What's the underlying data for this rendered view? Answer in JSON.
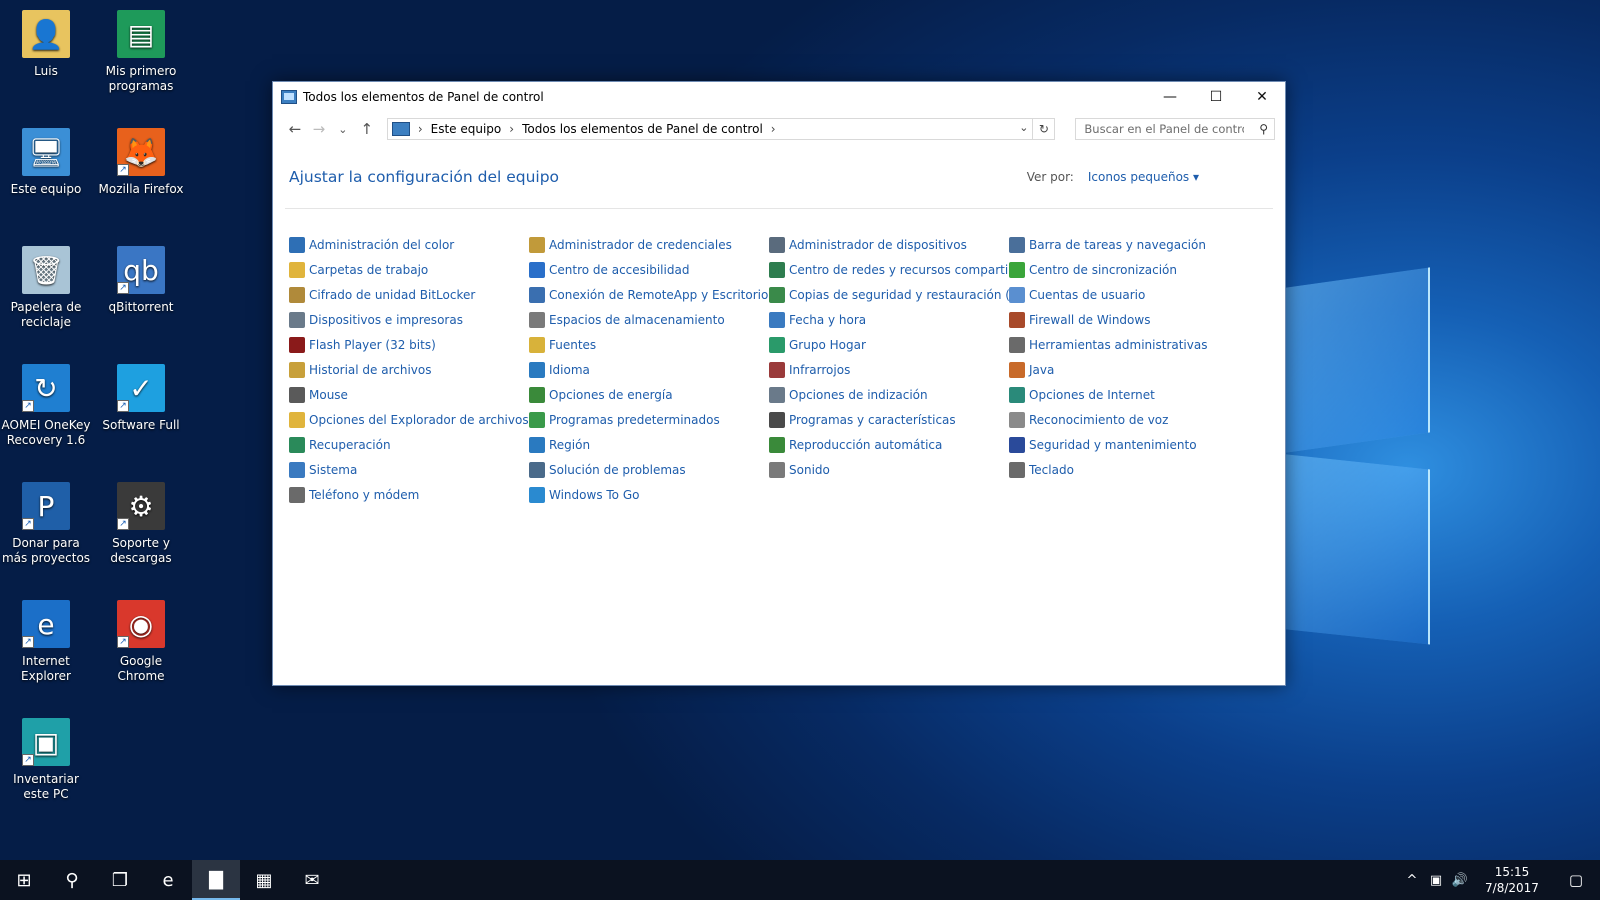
{
  "desktop": {
    "icons": [
      {
        "label": "Luis",
        "icon": "user-folder-icon",
        "bg": "#e8c45f",
        "glyph": "👤"
      },
      {
        "label": "Mis primero programas",
        "icon": "programs-shortcut-icon",
        "bg": "#1e9a5a",
        "glyph": "▤"
      },
      {
        "label": "Este equipo",
        "icon": "computer-icon",
        "bg": "#3b8fd6",
        "glyph": "🖥"
      },
      {
        "label": "Mozilla Firefox",
        "icon": "firefox-icon",
        "bg": "#e8611c",
        "glyph": "🦊"
      },
      {
        "label": "Papelera de reciclaje",
        "icon": "recycle-bin-icon",
        "bg": "#a9c4d6",
        "glyph": "🗑"
      },
      {
        "label": "qBittorrent",
        "icon": "qbittorrent-icon",
        "bg": "#3a76c4",
        "glyph": "qb"
      },
      {
        "label": "AOMEI OneKey Recovery 1.6",
        "icon": "aomei-recovery-icon",
        "bg": "#1f7fd1",
        "glyph": "↻"
      },
      {
        "label": "Software Full",
        "icon": "software-full-icon",
        "bg": "#1ea0e0",
        "glyph": "✓"
      },
      {
        "label": "Donar para más proyectos",
        "icon": "paypal-icon",
        "bg": "#1f5fa8",
        "glyph": "P"
      },
      {
        "label": "Soporte y descargas",
        "icon": "support-gear-icon",
        "bg": "#3a3a3a",
        "glyph": "⚙"
      },
      {
        "label": "Internet Explorer",
        "icon": "internet-explorer-icon",
        "bg": "#1b6fc8",
        "glyph": "e"
      },
      {
        "label": "Google Chrome",
        "icon": "chrome-icon",
        "bg": "#d9382c",
        "glyph": "◉"
      },
      {
        "label": "Inventariar este PC",
        "icon": "inventory-icon",
        "bg": "#1fa0a8",
        "glyph": "▣"
      }
    ]
  },
  "window": {
    "title": "Todos los elementos de Panel de control",
    "minimize_label": "—",
    "maximize_label": "☐",
    "close_label": "✕",
    "nav": {
      "back": "←",
      "forward": "→",
      "recent": "⌄",
      "up": "↑"
    },
    "breadcrumb": [
      "Este equipo",
      "Todos los elementos de Panel de control"
    ],
    "breadcrumb_sep": "›",
    "search_placeholder": "Buscar en el Panel de control",
    "heading": "Ajustar la configuración del equipo",
    "view_by_label": "Ver por:",
    "view_by_value": "Iconos pequeños ▾"
  },
  "control_panel_items": [
    {
      "label": "Administración del color",
      "icon": "color-management-icon",
      "color": "#2e6fb5"
    },
    {
      "label": "Administrador de credenciales",
      "icon": "credential-manager-icon",
      "color": "#c19a3a"
    },
    {
      "label": "Administrador de dispositivos",
      "icon": "device-manager-icon",
      "color": "#5a6b7d"
    },
    {
      "label": "Barra de tareas y navegación",
      "icon": "taskbar-icon",
      "color": "#4a6f9a"
    },
    {
      "label": "Carpetas de trabajo",
      "icon": "work-folders-icon",
      "color": "#e0b43c"
    },
    {
      "label": "Centro de accesibilidad",
      "icon": "accessibility-icon",
      "color": "#2a6fc9"
    },
    {
      "label": "Centro de redes y recursos comparti...",
      "icon": "network-center-icon",
      "color": "#2e7d4f"
    },
    {
      "label": "Centro de sincronización",
      "icon": "sync-center-icon",
      "color": "#3aa53a"
    },
    {
      "label": "Cifrado de unidad BitLocker",
      "icon": "bitlocker-icon",
      "color": "#b08a3a"
    },
    {
      "label": "Conexión de RemoteApp y Escritorio",
      "icon": "remoteapp-icon",
      "color": "#3a6fb0"
    },
    {
      "label": "Copias de seguridad y restauración (...",
      "icon": "backup-restore-icon",
      "color": "#3a8a4a"
    },
    {
      "label": "Cuentas de usuario",
      "icon": "user-accounts-icon",
      "color": "#5a8fd0"
    },
    {
      "label": "Dispositivos e impresoras",
      "icon": "devices-printers-icon",
      "color": "#6a7a8a"
    },
    {
      "label": "Espacios de almacenamiento",
      "icon": "storage-spaces-icon",
      "color": "#7a7a7a"
    },
    {
      "label": "Fecha y hora",
      "icon": "date-time-icon",
      "color": "#3a7ac0"
    },
    {
      "label": "Firewall de Windows",
      "icon": "firewall-icon",
      "color": "#a84a2a"
    },
    {
      "label": "Flash Player (32 bits)",
      "icon": "flash-player-icon",
      "color": "#8a1a1a"
    },
    {
      "label": "Fuentes",
      "icon": "fonts-icon",
      "color": "#d8b23a"
    },
    {
      "label": "Grupo Hogar",
      "icon": "homegroup-icon",
      "color": "#2a9a6a"
    },
    {
      "label": "Herramientas administrativas",
      "icon": "admin-tools-icon",
      "color": "#6a6a6a"
    },
    {
      "label": "Historial de archivos",
      "icon": "file-history-icon",
      "color": "#c8a03a"
    },
    {
      "label": "Idioma",
      "icon": "language-icon",
      "color": "#2a7ac0"
    },
    {
      "label": "Infrarrojos",
      "icon": "infrared-icon",
      "color": "#9a3a3a"
    },
    {
      "label": "Java",
      "icon": "java-icon",
      "color": "#c86a2a"
    },
    {
      "label": "Mouse",
      "icon": "mouse-icon",
      "color": "#5a5a5a"
    },
    {
      "label": "Opciones de energía",
      "icon": "power-options-icon",
      "color": "#3a8a3a"
    },
    {
      "label": "Opciones de indización",
      "icon": "indexing-options-icon",
      "color": "#6a7a8a"
    },
    {
      "label": "Opciones de Internet",
      "icon": "internet-options-icon",
      "color": "#2a8a7a"
    },
    {
      "label": "Opciones del Explorador de archivos",
      "icon": "explorer-options-icon",
      "color": "#e0b43c"
    },
    {
      "label": "Programas predeterminados",
      "icon": "default-programs-icon",
      "color": "#3a9a4a"
    },
    {
      "label": "Programas y características",
      "icon": "programs-features-icon",
      "color": "#4a4a4a"
    },
    {
      "label": "Reconocimiento de voz",
      "icon": "speech-recognition-icon",
      "color": "#8a8a8a"
    },
    {
      "label": "Recuperación",
      "icon": "recovery-icon",
      "color": "#2a8a5a"
    },
    {
      "label": "Región",
      "icon": "region-icon",
      "color": "#2a7ac0"
    },
    {
      "label": "Reproducción automática",
      "icon": "autoplay-icon",
      "color": "#3a8a3a"
    },
    {
      "label": "Seguridad y mantenimiento",
      "icon": "security-maintenance-icon",
      "color": "#2a4a9a"
    },
    {
      "label": "Sistema",
      "icon": "system-icon",
      "color": "#3a7ac0"
    },
    {
      "label": "Solución de problemas",
      "icon": "troubleshooting-icon",
      "color": "#4a6a8a"
    },
    {
      "label": "Sonido",
      "icon": "sound-icon",
      "color": "#7a7a7a"
    },
    {
      "label": "Teclado",
      "icon": "keyboard-icon",
      "color": "#6a6a6a"
    },
    {
      "label": "Teléfono y módem",
      "icon": "phone-modem-icon",
      "color": "#6a6a6a"
    },
    {
      "label": "Windows To Go",
      "icon": "windows-to-go-icon",
      "color": "#2a8ad0"
    }
  ],
  "taskbar": {
    "buttons": [
      {
        "icon": "start-icon",
        "glyph": "⊞"
      },
      {
        "icon": "search-icon",
        "glyph": "⚲"
      },
      {
        "icon": "task-view-icon",
        "glyph": "❐"
      },
      {
        "icon": "edge-icon",
        "glyph": "e"
      },
      {
        "icon": "file-explorer-icon",
        "glyph": "▇",
        "active": true
      },
      {
        "icon": "store-icon",
        "glyph": "▦"
      },
      {
        "icon": "mail-icon",
        "glyph": "✉"
      }
    ],
    "tray": {
      "chevron": "^",
      "network": "▣",
      "volume": "🔊",
      "time": "15:15",
      "date": "7/8/2017",
      "notifications": "▢"
    }
  }
}
